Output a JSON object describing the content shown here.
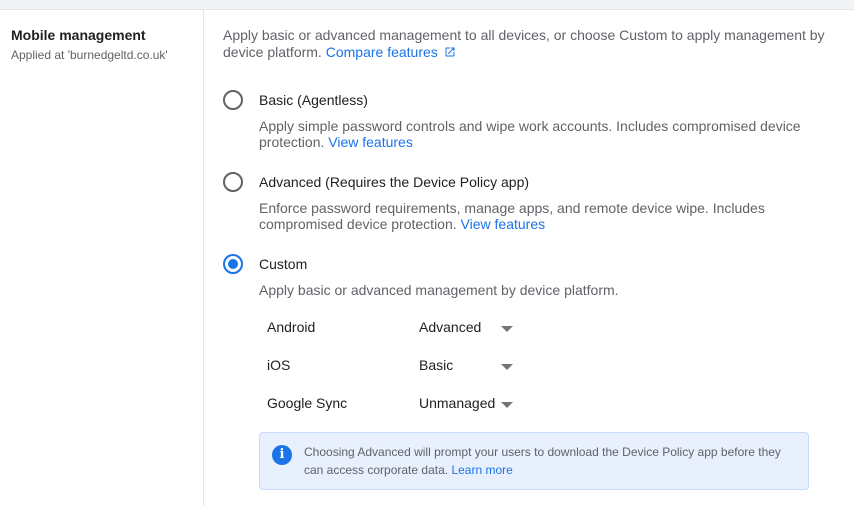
{
  "section": {
    "title": "Mobile management",
    "subtitle": "Applied at 'burnedgeltd.co.uk'"
  },
  "description": {
    "text": "Apply basic or advanced management to all devices, or choose Custom to apply management by device platform.",
    "link": "Compare features",
    "link_icon": "open-in-new-icon"
  },
  "options": [
    {
      "label": "Basic (Agentless)",
      "description": "Apply simple password controls and wipe work accounts. Includes compromised device protection.",
      "link": "View features",
      "selected": false
    },
    {
      "label": "Advanced (Requires the Device Policy app)",
      "description": "Enforce password requirements, manage apps, and remote device wipe. Includes compromised device protection.",
      "link": "View features",
      "selected": false
    },
    {
      "label": "Custom",
      "description": "Apply basic or advanced management by device platform.",
      "selected": true
    }
  ],
  "platforms": [
    {
      "name": "Android",
      "value": "Advanced"
    },
    {
      "name": "iOS",
      "value": "Basic"
    },
    {
      "name": "Google Sync",
      "value": "Unmanaged"
    }
  ],
  "info": {
    "icon": "info-icon",
    "glyph": "i",
    "text": "Choosing Advanced will prompt your users to download the Device Policy app before they can access corporate data.",
    "link": "Learn more"
  },
  "colors": {
    "accent": "#1a73e8",
    "info_background": "#e8f0fe",
    "secondary_text": "#5f6368"
  }
}
